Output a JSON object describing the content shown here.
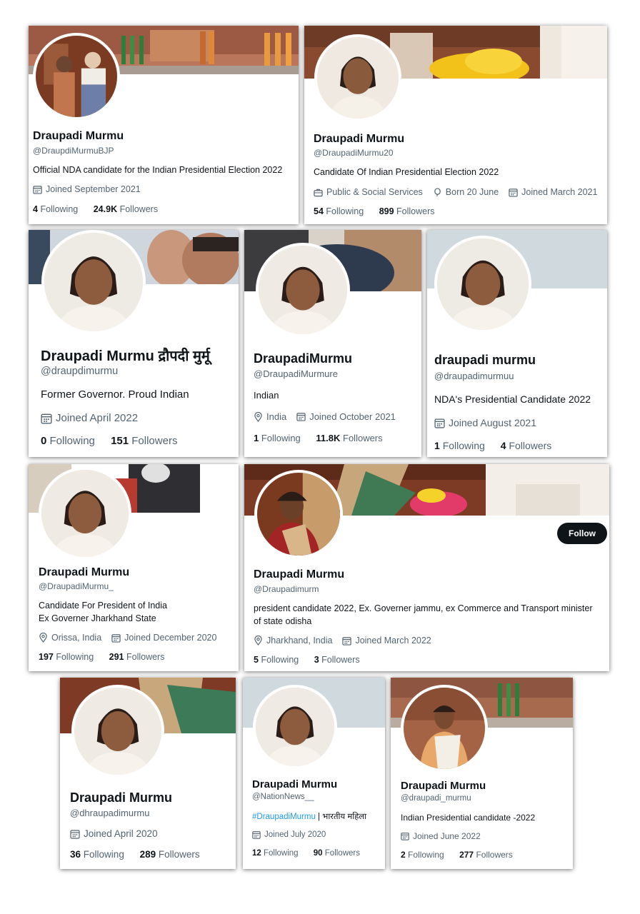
{
  "colors": {
    "text": "#0f1419",
    "secondary": "#536471",
    "link": "#1d9bf0",
    "follow_bg": "#0f1419"
  },
  "labels": {
    "following": "Following",
    "followers": "Followers"
  },
  "profiles": [
    {
      "name": "Draupadi Murmu",
      "handle": "@DraupdiMurmuBJP",
      "bio": "Official NDA candidate for the Indian Presidential Election 2022",
      "meta": [
        {
          "icon": "calendar-icon",
          "text": "Joined September 2021"
        }
      ],
      "following": "4",
      "followers": "24.9K"
    },
    {
      "name": "Draupadi Murmu",
      "handle": "@DraupadiMurmu20",
      "bio": "Candidate Of Indian Presidential Election 2022",
      "meta": [
        {
          "icon": "briefcase-icon",
          "text": "Public & Social Services"
        },
        {
          "icon": "balloon-icon",
          "text": "Born 20 June"
        },
        {
          "icon": "calendar-icon",
          "text": "Joined March 2021"
        }
      ],
      "following": "54",
      "followers": "899"
    },
    {
      "name": "Draupadi Murmu द्रौपदी मुर्मू",
      "handle": "@draupdimurmu",
      "bio": "Former Governor. Proud Indian",
      "meta": [
        {
          "icon": "calendar-icon",
          "text": "Joined April 2022"
        }
      ],
      "following": "0",
      "followers": "151"
    },
    {
      "name": "DraupadiMurmu",
      "handle": "@DraupadiMurmure",
      "bio": "Indian",
      "meta": [
        {
          "icon": "location-icon",
          "text": "India"
        },
        {
          "icon": "calendar-icon",
          "text": "Joined October 2021"
        }
      ],
      "following": "1",
      "followers": "11.8K"
    },
    {
      "name": "draupadi murmu",
      "handle": "@draupadimurmuu",
      "bio": "NDA's Presidential Candidate 2022",
      "meta": [
        {
          "icon": "calendar-icon",
          "text": "Joined August 2021"
        }
      ],
      "following": "1",
      "followers": "4"
    },
    {
      "name": "Draupadi Murmu",
      "handle": "@DraupadiMurmu_",
      "bio": "Candidate For President of India",
      "bio2": "Ex Governer Jharkhand State",
      "meta": [
        {
          "icon": "location-icon",
          "text": "Orissa, India"
        },
        {
          "icon": "calendar-icon",
          "text": "Joined December 2020"
        }
      ],
      "following": "197",
      "followers": "291"
    },
    {
      "name": "Draupadi Murmu",
      "handle": "@Draupadimurm",
      "bio": "president candidate 2022, Ex. Governer jammu, ex Commerce and Transport minister",
      "bio2": "of state odisha",
      "meta": [
        {
          "icon": "location-icon",
          "text": "Jharkhand, India"
        },
        {
          "icon": "calendar-icon",
          "text": "Joined March 2022"
        }
      ],
      "following": "5",
      "followers": "3",
      "follow_label": "Follow"
    },
    {
      "name": "Draupadi Murmu",
      "handle": "@dhraupadimurmu",
      "meta": [
        {
          "icon": "calendar-icon",
          "text": "Joined April 2020"
        }
      ],
      "following": "36",
      "followers": "289"
    },
    {
      "name": "Draupadi Murmu",
      "handle": "@NationNews__",
      "bio_link": "#DraupadiMurmu",
      "bio": " | भारतीय महिला",
      "meta": [
        {
          "icon": "calendar-icon",
          "text": "Joined July 2020"
        }
      ],
      "following": "12",
      "followers": "90"
    },
    {
      "name": "Draupadi Murmu",
      "handle": "@draupadi_murmu",
      "bio": "Indian Presidential candidate -2022",
      "meta": [
        {
          "icon": "calendar-icon",
          "text": "Joined June 2022"
        }
      ],
      "following": "2",
      "followers": "277"
    }
  ]
}
